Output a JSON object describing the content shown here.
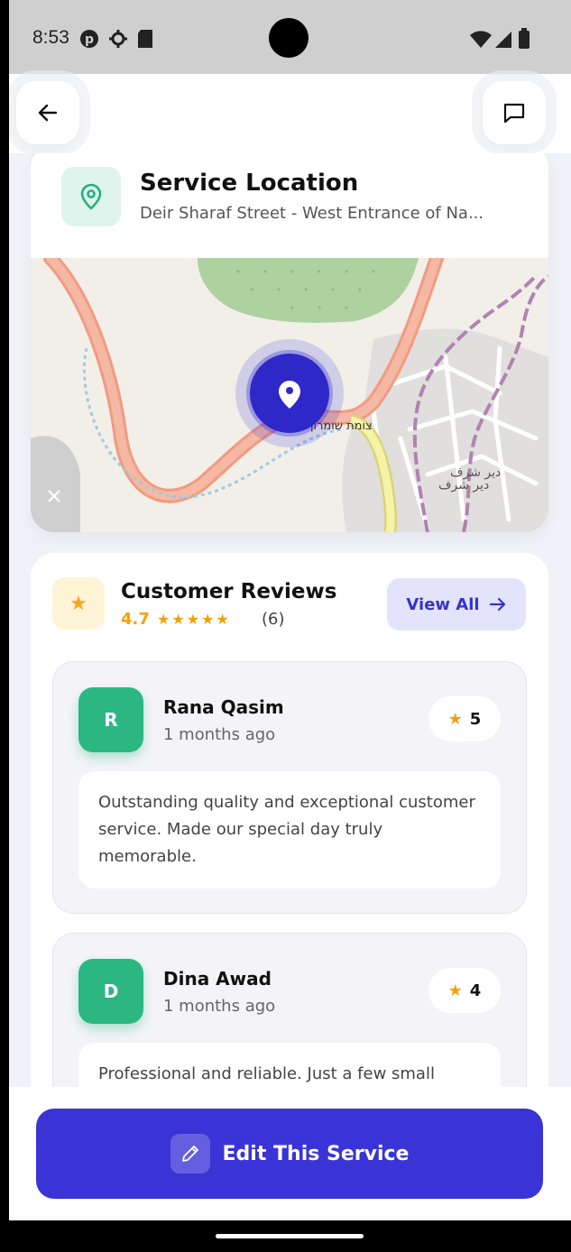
{
  "status_bar": {
    "time": "8:53"
  },
  "location": {
    "title": "Service Location",
    "address": "Deir Sharaf Street - West Entrance of Na...",
    "map_labels": [
      "צומת שומרון",
      "دير شرف",
      "دير شرف"
    ]
  },
  "reviews": {
    "title": "Customer Reviews",
    "rating": "4.7",
    "stars": "★★★★★",
    "count": "(6)",
    "view_all_label": "View All",
    "items": [
      {
        "initial": "R",
        "name": "Rana Qasim",
        "time": "1 months ago",
        "score": "5",
        "text": "Outstanding quality and exceptional customer service. Made our special day truly memorable."
      },
      {
        "initial": "D",
        "name": "Dina Awad",
        "time": "1 months ago",
        "score": "4",
        "text": "Professional and reliable. Just a few small"
      }
    ]
  },
  "actions": {
    "edit_label": "Edit This Service"
  },
  "colors": {
    "primary": "#3a33d6",
    "accent_green": "#2cb682",
    "star": "#f5a000",
    "background": "#f1f2f8"
  }
}
